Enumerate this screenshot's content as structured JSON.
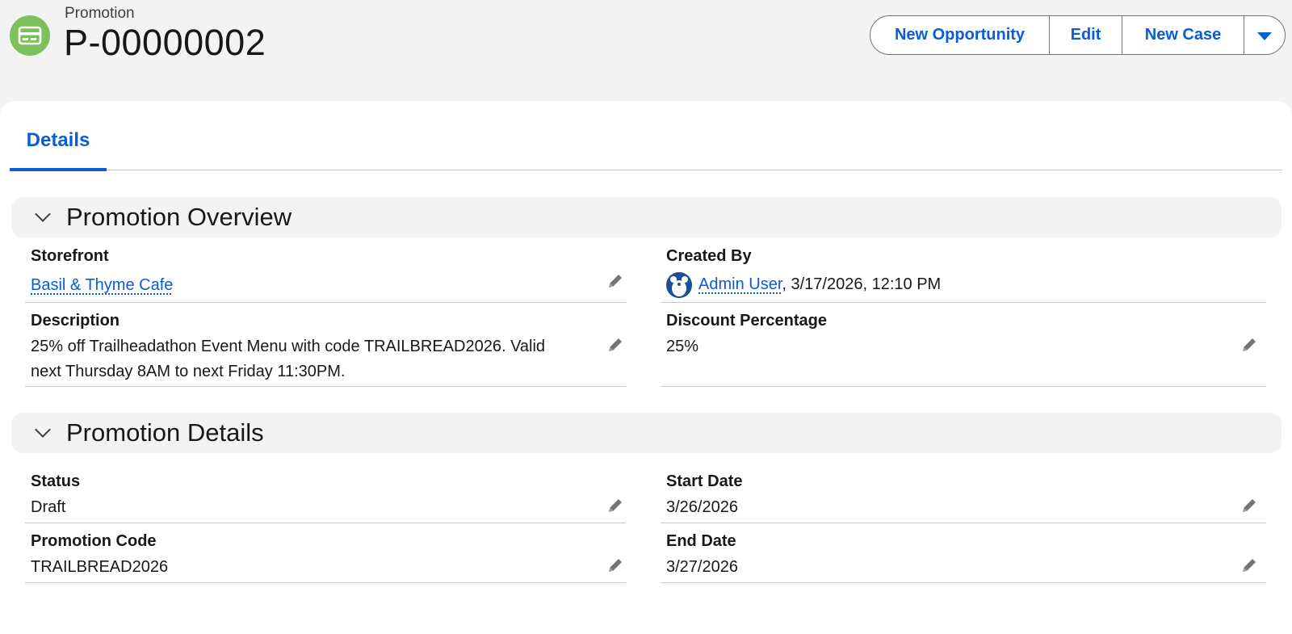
{
  "header": {
    "object_type": "Promotion",
    "record_name": "P-00000002",
    "icon": "promotion-card-icon",
    "icon_color": "#7cc15b",
    "buttons": {
      "new_opportunity": "New Opportunity",
      "edit": "Edit",
      "new_case": "New Case"
    }
  },
  "tabs": {
    "details": "Details"
  },
  "sections": {
    "overview": {
      "title": "Promotion Overview",
      "storefront_label": "Storefront",
      "storefront_value": "Basil & Thyme Cafe",
      "created_by_label": "Created By",
      "created_by_user": "Admin User",
      "created_by_sep": ",",
      "created_by_date": "3/17/2026, 12:10 PM",
      "description_label": "Description",
      "description_line1": "25% off Trailheadathon Event Menu with code TRAILBREAD2026. Valid",
      "description_line2": "next Thursday 8AM to next Friday 11:30PM.",
      "discount_label": "Discount Percentage",
      "discount_value": "25%"
    },
    "details": {
      "title": "Promotion Details",
      "status_label": "Status",
      "status_value": "Draft",
      "start_label": "Start Date",
      "start_value": "3/26/2026",
      "code_label": "Promotion Code",
      "code_value": "TRAILBREAD2026",
      "end_label": "End Date",
      "end_value": "3/27/2026"
    }
  },
  "colors": {
    "brand_blue": "#0b5cd5",
    "page_bg": "#f3f3f3",
    "divider": "#c9c9c9"
  }
}
